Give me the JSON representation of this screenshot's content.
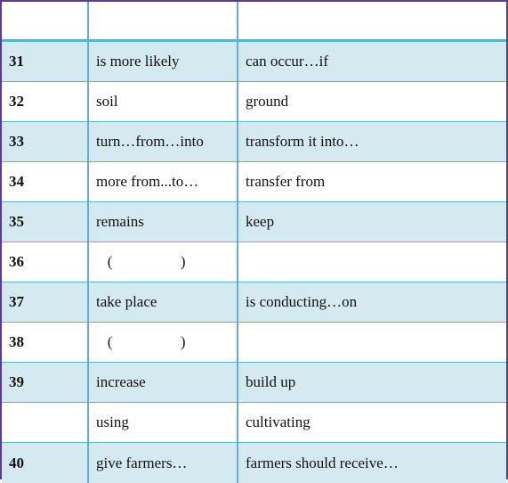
{
  "table": {
    "header": [
      "",
      "",
      ""
    ],
    "rows": [
      {
        "num": "31",
        "col2": "is more likely",
        "col3": "can occur…if"
      },
      {
        "num": "32",
        "col2": "soil",
        "col3": "ground"
      },
      {
        "num": "33",
        "col2": "turn…from…into",
        "col3": "transform it into…"
      },
      {
        "num": "34",
        "col2": "more from...to…",
        "col3": "transfer from"
      },
      {
        "num": "35",
        "col2": "remains",
        "col3": "keep"
      },
      {
        "num": "36",
        "col2": "   (                  )",
        "col3": ""
      },
      {
        "num": "37",
        "col2": "take place",
        "col3": "is conducting…on"
      },
      {
        "num": "38",
        "col2": "   (                  )",
        "col3": ""
      },
      {
        "num": "39",
        "col2": "increase",
        "col3": "build up"
      },
      {
        "num": "",
        "col2": "using",
        "col3": "cultivating"
      },
      {
        "num": "40",
        "col2": "give farmers…",
        "col3": "farmers should receive…"
      }
    ]
  }
}
